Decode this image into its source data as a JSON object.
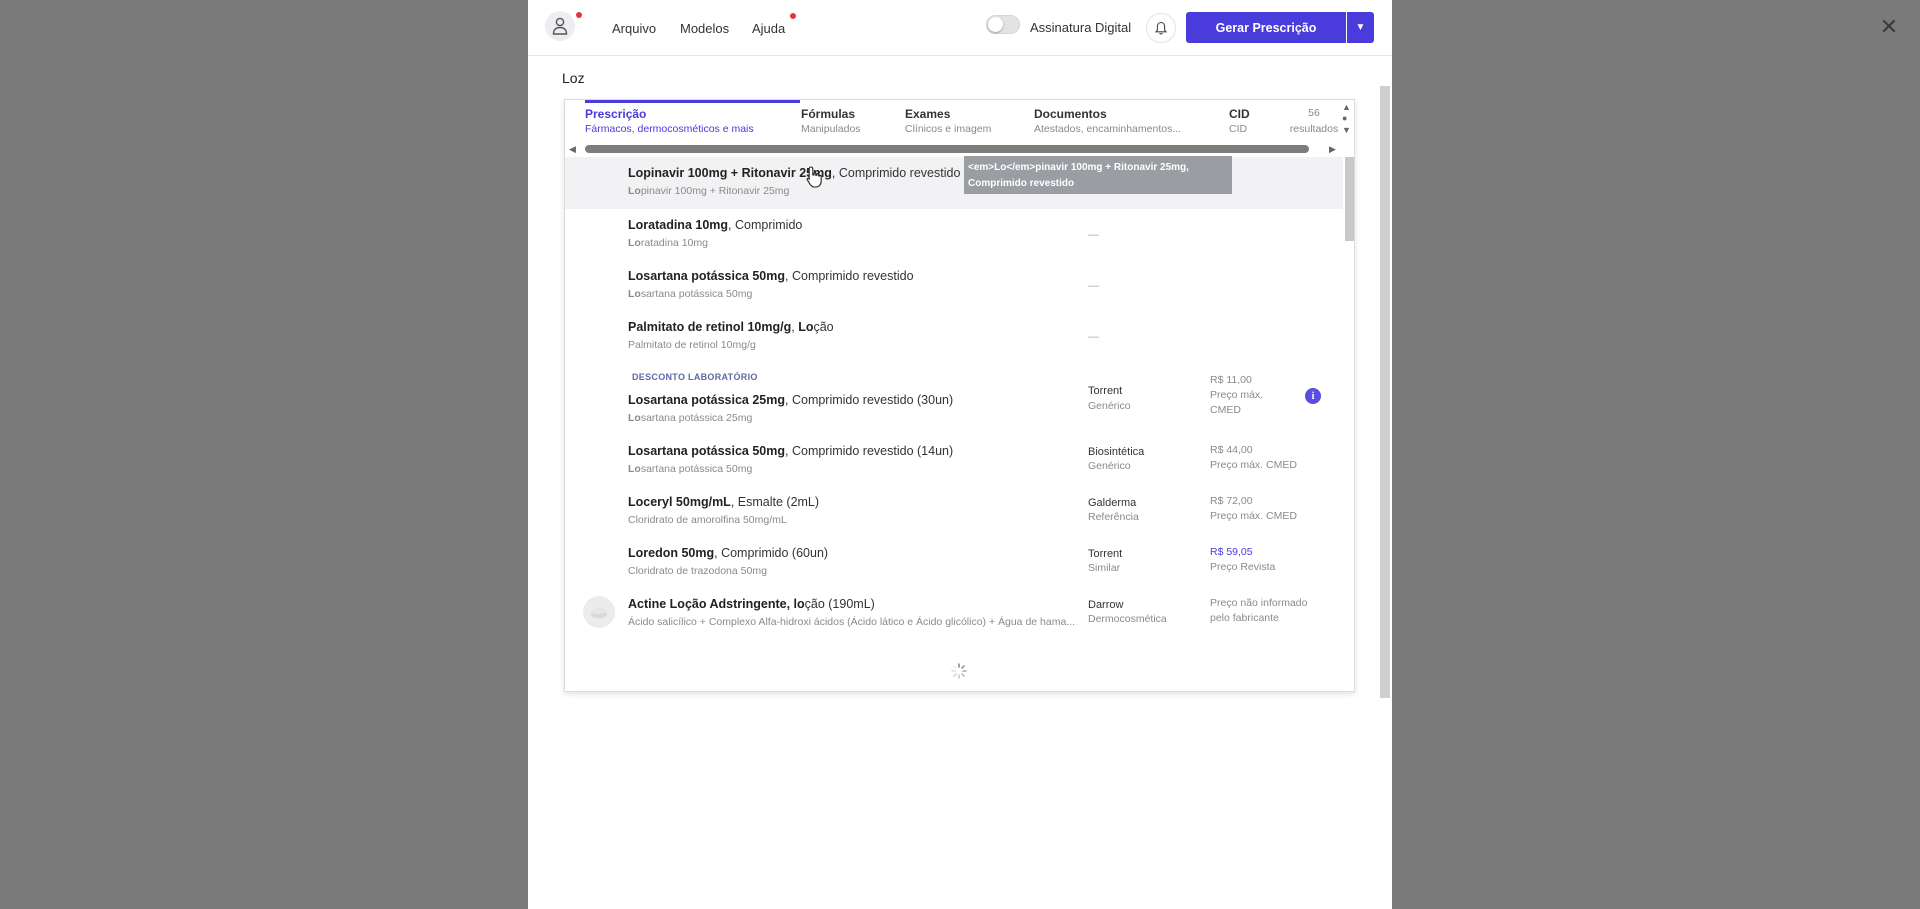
{
  "header": {
    "menu": [
      "Arquivo",
      "Modelos",
      "Ajuda"
    ],
    "toggle_label": "Assinatura Digital",
    "generate_button": "Gerar Prescrição"
  },
  "search": {
    "value": "Loz"
  },
  "tabs": [
    {
      "title": "Prescrição",
      "subtitle": "Fármacos, dermocosméticos e mais"
    },
    {
      "title": "Fórmulas",
      "subtitle": "Manipulados"
    },
    {
      "title": "Exames",
      "subtitle": "Clínicos e imagem"
    },
    {
      "title": "Documentos",
      "subtitle": "Atestados, encaminhamentos..."
    },
    {
      "title": "CID",
      "subtitle": "CID"
    }
  ],
  "results_count": {
    "number": "56",
    "label": "resultados"
  },
  "tooltip": "<em>Lo</em>pinavir 100mg + Ritonavir 25mg, Comprimido revestido",
  "section_label": "DESCONTO LABORATÓRIO",
  "dash": "—",
  "results": [
    {
      "name_bold": "Lopinavir 100mg + Ritonavir 25mg",
      "name_rest": ", Comprimido revestido",
      "sub_bold": "Lo",
      "sub_rest": "pinavir 100mg + Ritonavir 25mg"
    },
    {
      "name_bold": "Loratadina 10mg",
      "name_rest": ", Comprimido",
      "sub_bold": "Lo",
      "sub_rest": "ratadina 10mg"
    },
    {
      "name_bold": "Losartana potássica 50mg",
      "name_rest": ", Comprimido revestido",
      "sub_bold": "Lo",
      "sub_rest": "sartana potássica 50mg"
    },
    {
      "name_bold": "Palmitato de retinol 10mg/g",
      "name_rest": ", ",
      "name_bold2": "Lo",
      "name_rest2": "ção",
      "sub_bold": "",
      "sub_rest": "Palmitato de retinol 10mg/g"
    },
    {
      "name_bold": "Losartana potássica 25mg",
      "name_rest": ", Comprimido revestido (30un)",
      "sub_bold": "Lo",
      "sub_rest": "sartana potássica 25mg",
      "lab": "Torrent",
      "type": "Genérico",
      "price": "R$ 11,00",
      "price_note": "Preço máx.",
      "price_note2": "CMED"
    },
    {
      "name_bold": "Losartana potássica 50mg",
      "name_rest": ", Comprimido revestido (14un)",
      "sub_bold": "Lo",
      "sub_rest": "sartana potássica 50mg",
      "lab": "Biosintética",
      "type": "Genérico",
      "price": "R$ 44,00",
      "price_note": "Preço máx. CMED"
    },
    {
      "name_bold": "Loceryl 50mg/mL",
      "name_rest": ", Esmalte (2mL)",
      "sub_bold": "",
      "sub_rest": "Cloridrato de amorolfina 50mg/mL",
      "lab": "Galderma",
      "type": "Referência",
      "price": "R$ 72,00",
      "price_note": "Preço máx. CMED"
    },
    {
      "name_bold": "Loredon 50mg",
      "name_rest": ", Comprimido (60un)",
      "sub_bold": "",
      "sub_rest": "Cloridrato de trazodona 50mg",
      "lab": "Torrent",
      "type": "Similar",
      "price": "R$ 59,05",
      "price_note": "Preço Revista"
    },
    {
      "name_bold": "Actine Loção Adstringente, lo",
      "name_rest": "ção (190mL)",
      "sub_bold": "",
      "sub_rest": "Ácido salicílico + Complexo Alfa-hidroxi ácidos (Ácido lático e Ácido glicólico) + Água de hama...",
      "lab": "Darrow",
      "type": "Dermocosmética",
      "price": "Preço não informado",
      "price_note": "pelo fabricante"
    }
  ]
}
